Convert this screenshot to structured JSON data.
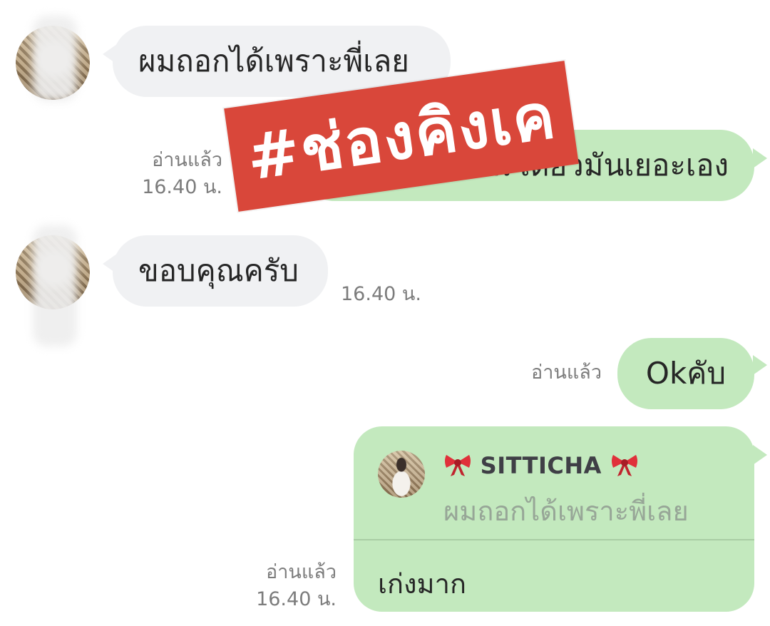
{
  "chat": {
    "messages": [
      {
        "side": "left",
        "text": "ผมถอกได้เพราะพี่เลย"
      },
      {
        "side": "right",
        "text": "ทำงาน เดี๋ยวมันเยอะเอง",
        "read": "อ่านแล้ว",
        "time": "16.40 น."
      },
      {
        "side": "left",
        "text": "ขอบคุณครับ",
        "time": "16.40 น."
      },
      {
        "side": "right",
        "text": "Okคับ",
        "read": "อ่านแล้ว"
      },
      {
        "side": "right",
        "reply_to": {
          "sender": "SITTICHA",
          "quote": "ผมถอกได้เพราะพี่เลย"
        },
        "text": "เก่งมาก",
        "read": "อ่านแล้ว",
        "time": "16.40 น."
      }
    ]
  },
  "overlay": {
    "hashtag": "#ช่องคิงเค"
  },
  "colors": {
    "incoming_bubble": "#f0f1f3",
    "outgoing_bubble": "#c3e9be",
    "stamp": "#d9473a"
  },
  "icons": {
    "bow": "ribbon-bow-icon"
  }
}
